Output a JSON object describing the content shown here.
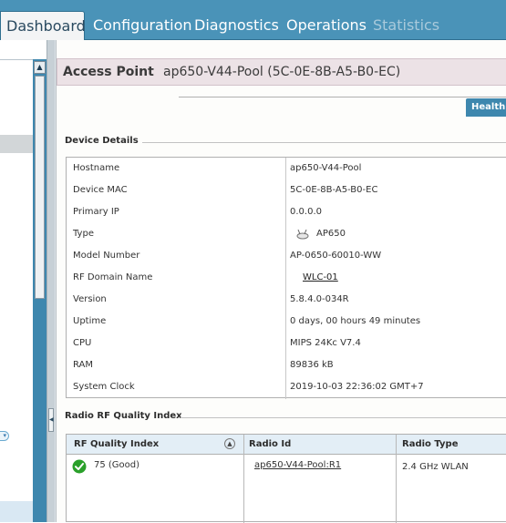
{
  "nav": {
    "tabs": [
      {
        "label": "Dashboard"
      },
      {
        "label": "Configuration"
      },
      {
        "label": "Diagnostics"
      },
      {
        "label": "Operations"
      },
      {
        "label": "Statistics"
      }
    ]
  },
  "header": {
    "title": "Access Point",
    "device": "ap650-V44-Pool (5C-0E-8B-A5-B0-EC)"
  },
  "health_tab": "Health",
  "device_details": {
    "title": "Device Details",
    "rows": [
      {
        "label": "Hostname",
        "value": "ap650-V44-Pool"
      },
      {
        "label": "Device MAC",
        "value": "5C-0E-8B-A5-B0-EC"
      },
      {
        "label": "Primary IP",
        "value": "0.0.0.0"
      },
      {
        "label": "Type",
        "value": "AP650"
      },
      {
        "label": "Model Number",
        "value": "AP-0650-60010-WW"
      },
      {
        "label": "RF Domain Name",
        "value": "WLC-01"
      },
      {
        "label": "Version",
        "value": "5.8.4.0-034R"
      },
      {
        "label": "Uptime",
        "value": "0 days, 00 hours 49 minutes"
      },
      {
        "label": "CPU",
        "value": "MIPS 24Kc V7.4"
      },
      {
        "label": "RAM",
        "value": "89836 kB"
      },
      {
        "label": "System Clock",
        "value": "2019-10-03 22:36:02 GMT+7"
      }
    ]
  },
  "rf_quality": {
    "title": "Radio RF Quality Index",
    "columns": [
      "RF Quality Index",
      "Radio Id",
      "Radio Type"
    ],
    "rows": [
      {
        "quality": "75 (Good)",
        "radio_id": "ap650-V44-Pool:R1",
        "radio_type": "2.4 GHz WLAN"
      }
    ]
  },
  "colors": {
    "nav_bg": "#4a93b8",
    "accent": "#3e87ae",
    "header_bg": "#ece2e6",
    "good": "#2aa02a"
  },
  "icons": {
    "scroll_up": "▲",
    "sort": "▲",
    "collapse": "◀"
  }
}
